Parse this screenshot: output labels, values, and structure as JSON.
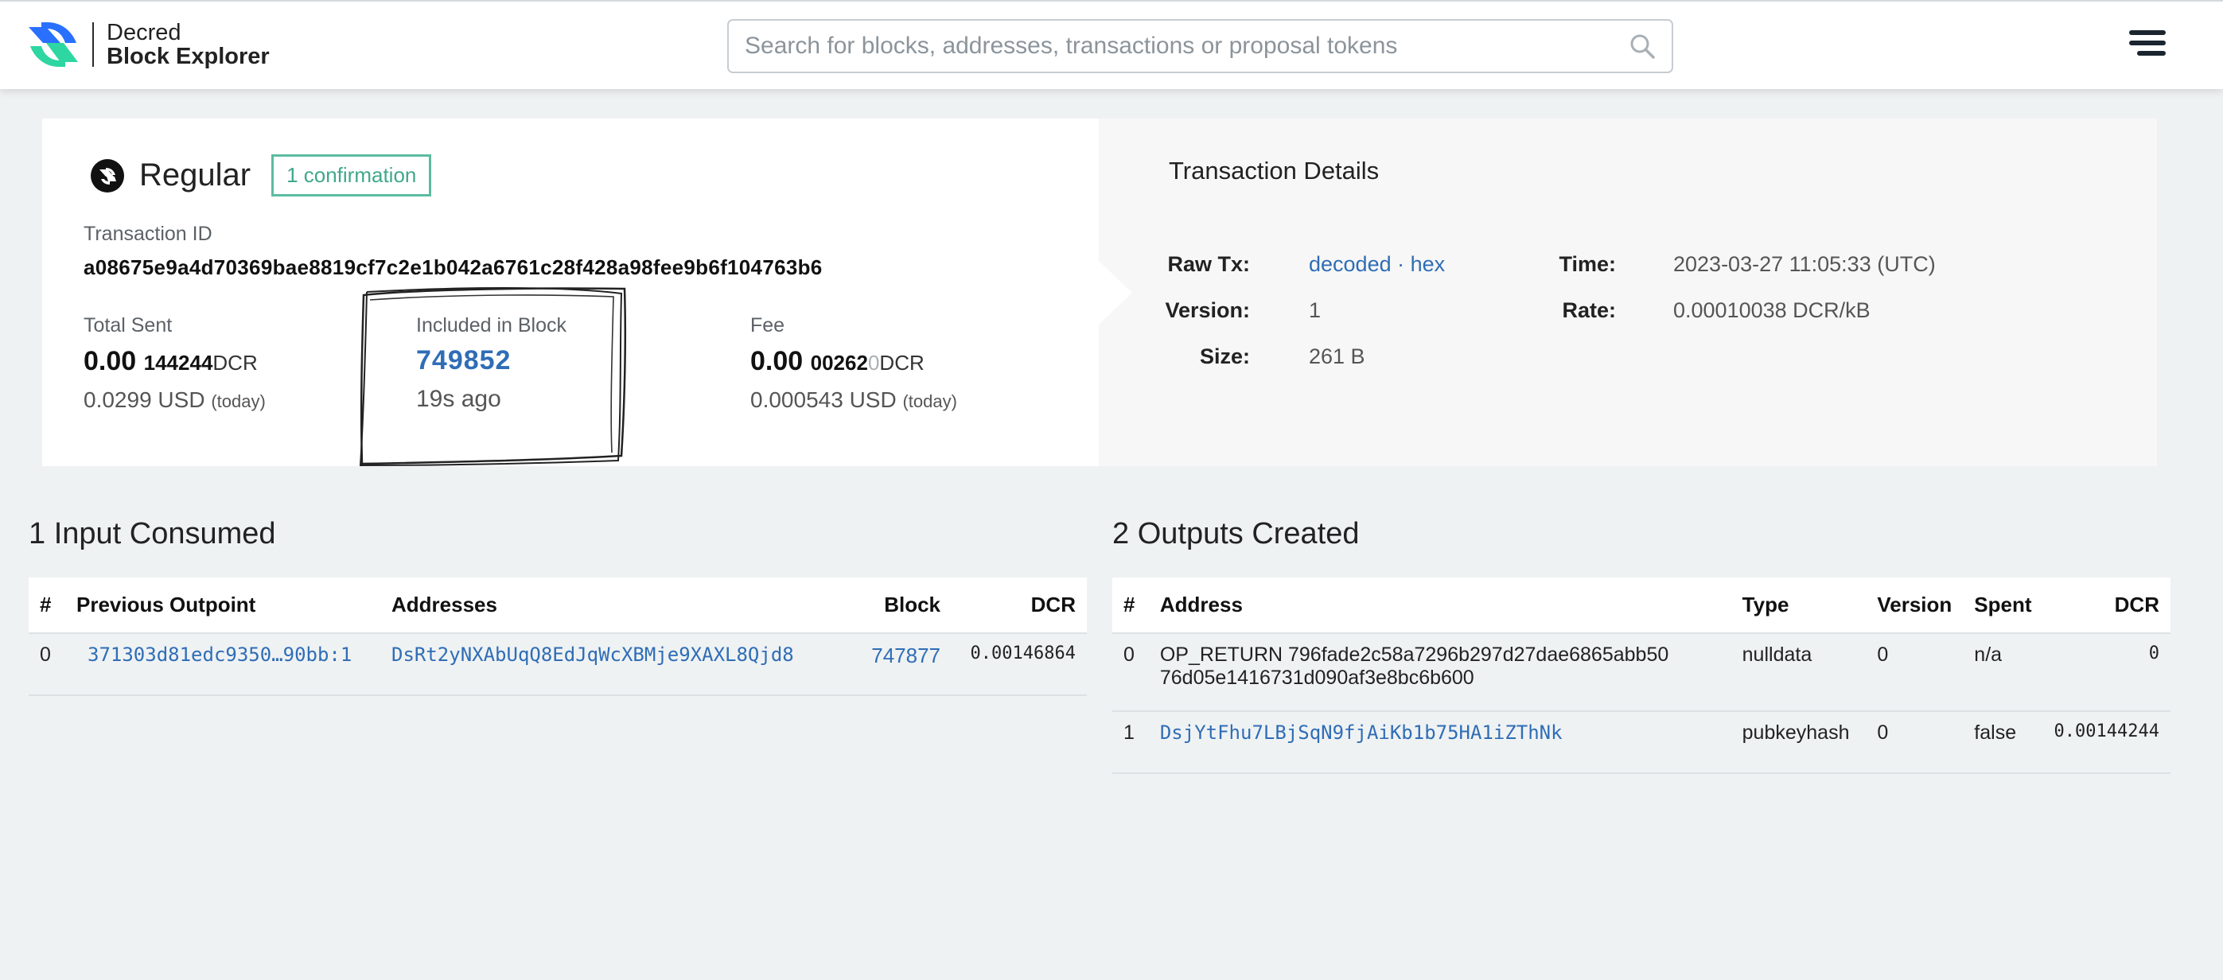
{
  "header": {
    "logo_line1": "Decred",
    "logo_line2": "Block Explorer",
    "search_placeholder": "Search for blocks, addresses, transactions or proposal tokens"
  },
  "summary": {
    "type": "Regular",
    "confirmations": "1 confirmation",
    "txid_label": "Transaction ID",
    "txid": "a08675e9a4d70369bae8819cf7c2e1b042a6761c28f428a98fee9b6f104763b6",
    "total_sent_label": "Total Sent",
    "total_sent_main": "0.00",
    "total_sent_small": "144244",
    "total_sent_unit": "DCR",
    "total_sent_usd": "0.0299",
    "included_label": "Included in Block",
    "block": "749852",
    "block_age": "19s ago",
    "fee_label": "Fee",
    "fee_main": "0.00",
    "fee_small": "00262",
    "fee_faded": "0",
    "fee_unit": "DCR",
    "fee_usd": "0.000543",
    "usd_unit": "USD",
    "today": "(today)"
  },
  "details": {
    "title": "Transaction Details",
    "raw_tx_label": "Raw Tx:",
    "raw_decoded": "decoded",
    "raw_sep": " · ",
    "raw_hex": "hex",
    "version_label": "Version:",
    "version": "1",
    "size_label": "Size:",
    "size": "261 B",
    "time_label": "Time:",
    "time": "2023-03-27 11:05:33 (UTC)",
    "rate_label": "Rate:",
    "rate": "0.00010038 DCR/kB"
  },
  "inputs": {
    "title": "1 Input Consumed",
    "headers": [
      "#",
      "Previous Outpoint",
      "Addresses",
      "Block",
      "DCR"
    ],
    "rows": [
      {
        "idx": "0",
        "outpoint": "371303d81edc9350…90bb:1",
        "address": "DsRt2yNXAbUqQ8EdJqWcXBMje9XAXL8Qjd8",
        "block": "747877",
        "dcr": "0.00146864"
      }
    ]
  },
  "outputs": {
    "title": "2 Outputs Created",
    "headers": [
      "#",
      "Address",
      "Type",
      "Version",
      "Spent",
      "DCR"
    ],
    "rows": [
      {
        "idx": "0",
        "address_line1": "OP_RETURN 796fade2c58a7296b297d27dae6865abb50",
        "address_line2": "76d05e1416731d090af3e8bc6b600",
        "type": "nulldata",
        "version": "0",
        "spent": "n/a",
        "dcr": "0"
      },
      {
        "idx": "1",
        "address": "DsjYtFhu7LBjSqN9fjAiKb1b75HA1iZThNk",
        "type": "pubkeyhash",
        "version": "0",
        "spent": "false",
        "dcr": "0.00144244"
      }
    ]
  }
}
